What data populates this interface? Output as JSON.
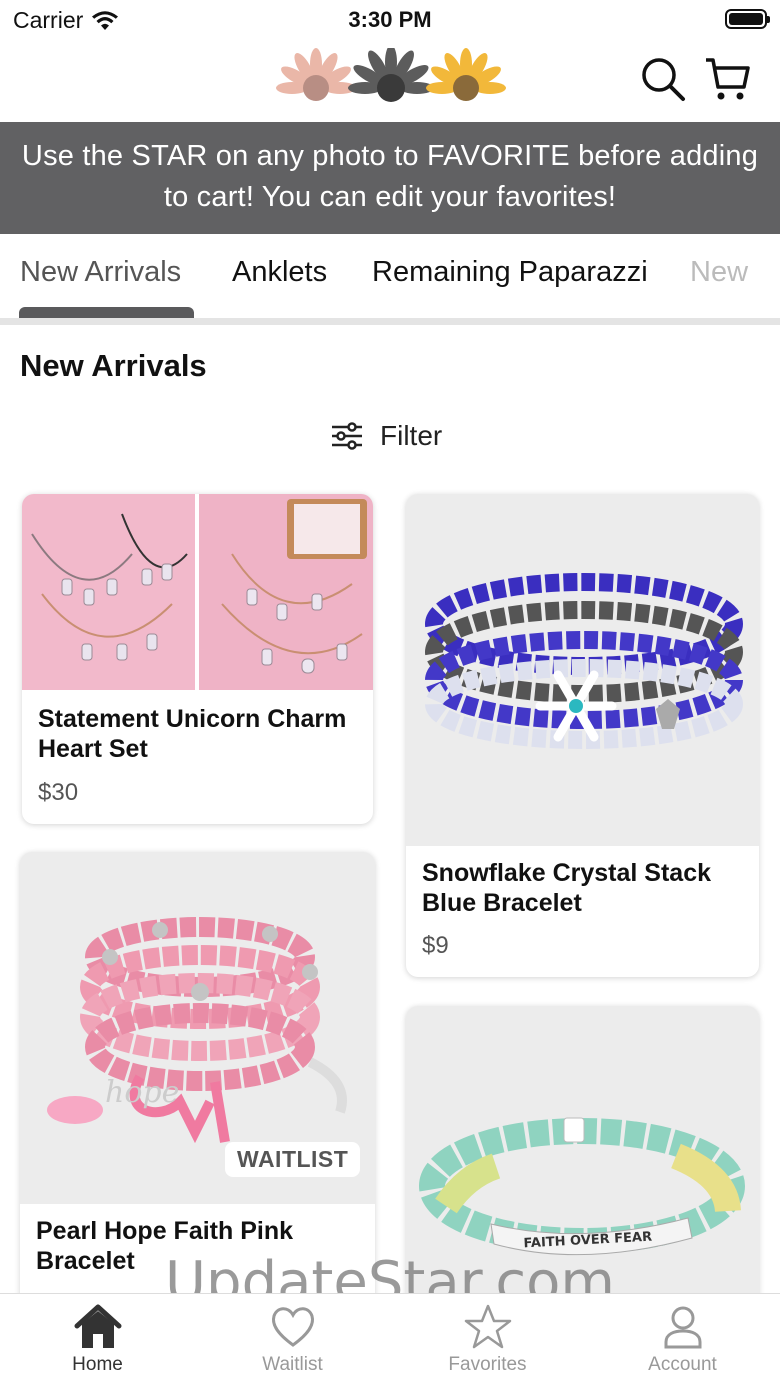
{
  "status_bar": {
    "carrier": "Carrier",
    "time": "3:30 PM"
  },
  "header": {
    "logo": "sunflower-logo",
    "icons": [
      "search-icon",
      "cart-icon"
    ]
  },
  "banner": {
    "line1": "Use the STAR on any photo to FAVORITE before adding",
    "line2": "to cart! You can edit your favorites!"
  },
  "tabs": [
    {
      "label": "New Arrivals",
      "active": true
    },
    {
      "label": "Anklets"
    },
    {
      "label": "Remaining Paparazzi"
    },
    {
      "label": "New"
    }
  ],
  "section_title": "New Arrivals",
  "filter_label": "Filter",
  "products": [
    {
      "name_line1": "Statement Unicorn Charm",
      "name_line2": "Heart Set",
      "price": "$30"
    },
    {
      "name_line1": "Snowflake Crystal Stack",
      "name_line2": "Blue Bracelet",
      "price": "$9"
    },
    {
      "name_line1": "Pearl Hope Faith Pink",
      "name_line2": "Bracelet",
      "badge": "WAITLIST"
    },
    {
      "image_text": "FAITH OVER FEAR"
    }
  ],
  "watermark": "UpdateStar.com",
  "bottom_nav": [
    {
      "label": "Home",
      "icon": "home-icon",
      "active": true
    },
    {
      "label": "Waitlist",
      "icon": "heart-icon"
    },
    {
      "label": "Favorites",
      "icon": "star-icon"
    },
    {
      "label": "Account",
      "icon": "user-icon"
    }
  ],
  "colors": {
    "banner_bg": "#616163",
    "tab_indicator": "#5a5a5c",
    "pink_bg": "#f0b6c8"
  }
}
